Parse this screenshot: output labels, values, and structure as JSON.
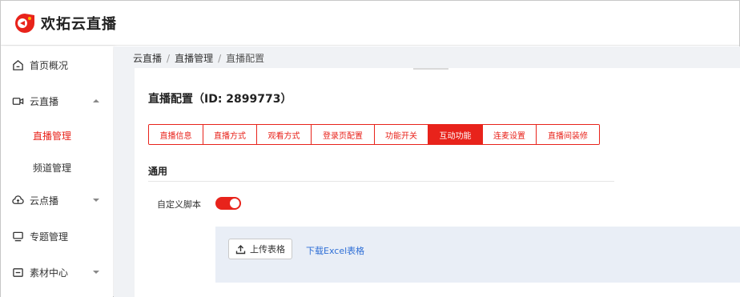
{
  "brand": {
    "name": "欢拓云直播",
    "logo_color": "#e8231b"
  },
  "sidebar": {
    "items": [
      {
        "label": "首页概况",
        "icon": "home-icon"
      },
      {
        "label": "云直播",
        "icon": "video-camera-icon",
        "expanded": true
      },
      {
        "label": "直播管理",
        "sub": true,
        "active": true
      },
      {
        "label": "频道管理",
        "sub": true
      },
      {
        "label": "云点播",
        "icon": "cloud-upload-icon",
        "expanded": false
      },
      {
        "label": "专题管理",
        "icon": "monitor-icon"
      },
      {
        "label": "素材中心",
        "icon": "folder-icon",
        "expanded": false
      }
    ]
  },
  "breadcrumb": {
    "items": [
      "云直播",
      "直播管理",
      "直播配置"
    ],
    "separator": "/"
  },
  "page": {
    "title": "直播配置（ID: 2899773）"
  },
  "tabs": [
    {
      "label": "直播信息"
    },
    {
      "label": "直播方式"
    },
    {
      "label": "观看方式"
    },
    {
      "label": "登录页配置"
    },
    {
      "label": "功能开关"
    },
    {
      "label": "互动功能",
      "active": true
    },
    {
      "label": "连麦设置"
    },
    {
      "label": "直播间装修"
    }
  ],
  "section": {
    "title": "通用",
    "custom_script_label": "自定义脚本",
    "custom_script_enabled": true,
    "upload_button": "上传表格",
    "download_link": "下载Excel表格"
  },
  "colors": {
    "accent": "#e8231b",
    "link": "#2f6fd6",
    "upload_bg": "#e9eef6"
  }
}
